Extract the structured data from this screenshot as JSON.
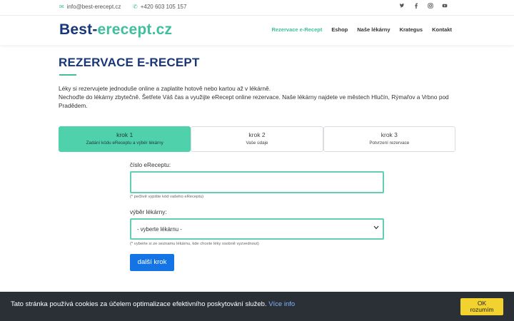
{
  "topbar": {
    "email": "info@best-erecept.cz",
    "phone": "+420 603 105 157",
    "social": [
      "twitter-icon",
      "facebook-icon",
      "instagram-icon",
      "youtube-icon"
    ]
  },
  "header": {
    "logo_part1": "Best-",
    "logo_part2": "erecept.cz",
    "nav": [
      {
        "label": "Rezervace e-Recept"
      },
      {
        "label": "Eshop"
      },
      {
        "label": "Naše lékárny"
      },
      {
        "label": "Krategus"
      },
      {
        "label": "Kontakt"
      }
    ]
  },
  "main": {
    "title": "REZERVACE E-RECEPT",
    "intro_line1": "Léky si rezervujete jednoduše online a zaplatite hotově nebo kartou až v lékárně.",
    "intro_line2": "Nechoďte do lékárny zbytečně. Šetřete Váš čas a využijte eRecept online rezervace. Naše lékárny najdete ve městech Hlučín, Rýmařov a Vrbno pod Pradědem.",
    "steps": [
      {
        "title": "krok 1",
        "sub": "Zadání kódu eReceptu a výběr lékárny"
      },
      {
        "title": "krok 2",
        "sub": "Vaše údaje"
      },
      {
        "title": "krok 3",
        "sub": "Potvrzení rezervace"
      }
    ]
  },
  "form": {
    "code_label": "číslo eReceptu:",
    "code_value": "",
    "code_hint": "(* pečlivě vypište kód vašeho eReceptu)",
    "pharmacy_label": "výběr lékárny:",
    "pharmacy_selected": "- vyberte lékárnu -",
    "pharmacy_hint": "(* vyberte si ze seznamu lékárnu, kde chcete léky osobně vyzvednout)",
    "next_button": "další krok"
  },
  "cookie": {
    "text": "Tato stránka používá cookies za účelem optimalizace efektivního poskytování služeb.",
    "more": "Více info",
    "ok_line1": "OK",
    "ok_line2": "rozumím"
  },
  "colors": {
    "brand_blue": "#17377a",
    "accent_green": "#3fbf9c",
    "button_blue": "#1474e6",
    "cookie_yellow": "#f2d22f"
  }
}
